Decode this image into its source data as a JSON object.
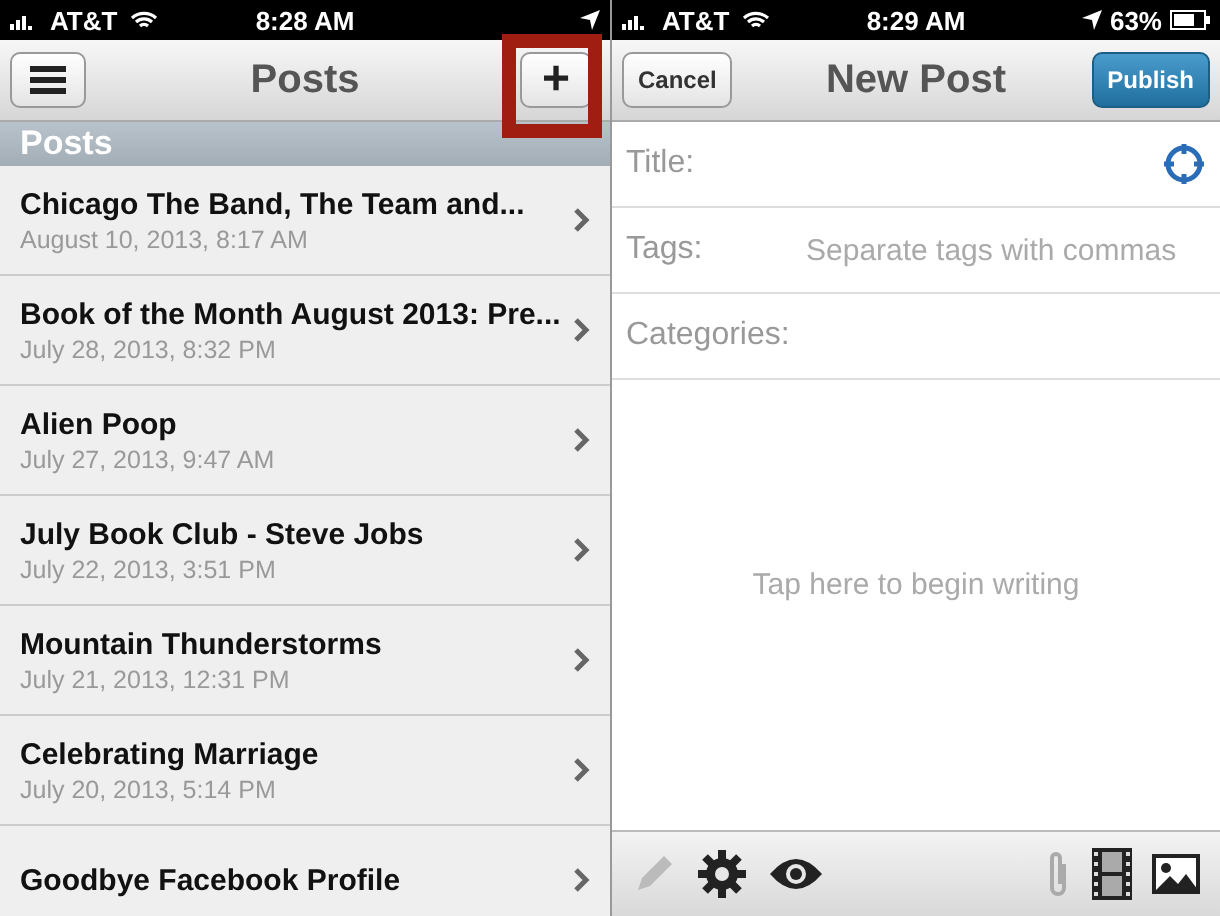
{
  "left": {
    "status_bar": {
      "carrier": "AT&T",
      "time": "8:28 AM"
    },
    "nav": {
      "title": "Posts",
      "add_button": {
        "label": "+",
        "highlighted": true
      }
    },
    "section_header": "Posts",
    "posts": [
      {
        "title": "Chicago The Band, The Team and...",
        "date": "August 10, 2013, 8:17 AM"
      },
      {
        "title": "Book of the Month August 2013: Pre...",
        "date": "July 28, 2013, 8:32 PM"
      },
      {
        "title": "Alien Poop",
        "date": "July 27, 2013, 9:47 AM"
      },
      {
        "title": "July Book Club - Steve Jobs",
        "date": "July 22, 2013, 3:51 PM"
      },
      {
        "title": "Mountain Thunderstorms",
        "date": "July 21, 2013, 12:31 PM"
      },
      {
        "title": "Celebrating Marriage",
        "date": "July 20, 2013, 5:14 PM"
      },
      {
        "title": "Goodbye Facebook Profile"
      }
    ]
  },
  "right": {
    "status_bar": {
      "carrier": "AT&T",
      "time": "8:29 AM",
      "battery": "63%"
    },
    "nav": {
      "cancel": "Cancel",
      "title": "New Post",
      "publish": "Publish"
    },
    "fields": [
      {
        "label": "Title:"
      },
      {
        "label": "Tags:",
        "placeholder": "Separate tags with commas"
      },
      {
        "label": "Categories:"
      }
    ],
    "editor_placeholder": "Tap here to begin writing"
  }
}
